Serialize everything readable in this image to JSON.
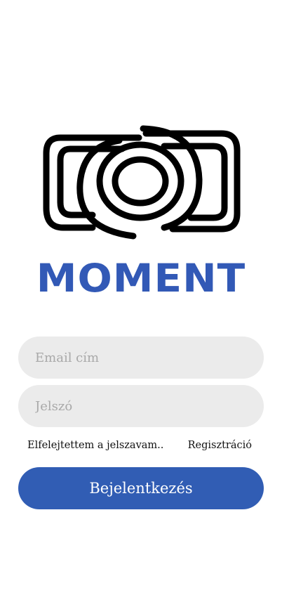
{
  "brand": {
    "name": "MOMENT",
    "color": "#3259b6",
    "logo_icon": "camera-lens-logo-icon"
  },
  "form": {
    "email_placeholder": "Email cím",
    "email_value": "",
    "password_placeholder": "Jelszó",
    "password_value": "",
    "forgot_password_label": "Elfelejtettem a jelszavam..",
    "register_label": "Regisztráció",
    "login_button_label": "Bejelentkezés"
  },
  "colors": {
    "accent": "#315db4",
    "field_background": "#ebebeb",
    "background": "#ffffff"
  }
}
